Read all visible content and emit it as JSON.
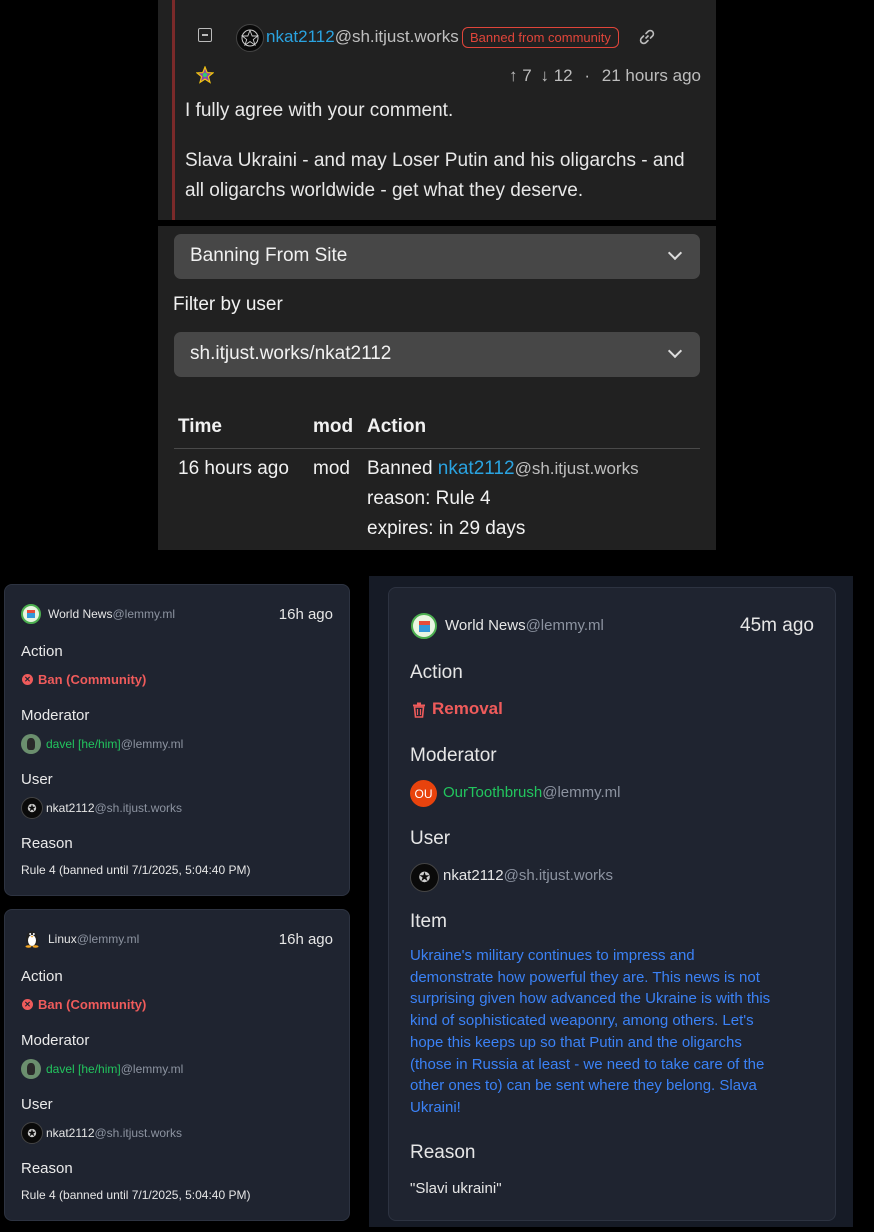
{
  "comment": {
    "username": "nkat2112",
    "instance": "@sh.itjust.works",
    "badge": "Banned from community",
    "upvotes": "7",
    "downvotes": "12",
    "separator": "·",
    "time": "21 hours ago",
    "paragraph1": "I fully agree with your comment.",
    "paragraph2": "Slava Ukraini - and may Loser Putin and his oligarchs - and all oligarchs worldwide - get what they deserve."
  },
  "modlog_mobile": {
    "action_filter": "Banning From Site",
    "filter_label": "Filter by user",
    "user_filter": "sh.itjust.works/nkat2112",
    "headers": [
      "Time",
      "mod",
      "Action"
    ],
    "row": {
      "time": "16 hours ago",
      "mod": "mod",
      "action_prefix": "Banned",
      "user": "nkat2112",
      "user_instance": "@sh.itjust.works",
      "reason": "reason: Rule 4",
      "expires": "expires: in 29 days"
    }
  },
  "card_world_ban": {
    "community": "World News",
    "community_instance": "@lemmy.ml",
    "time": "16h ago",
    "action_heading": "Action",
    "action": "Ban (Community)",
    "moderator_heading": "Moderator",
    "moderator": "davel [he/him]",
    "moderator_instance": "@lemmy.ml",
    "user_heading": "User",
    "user": "nkat2112",
    "user_instance": "@sh.itjust.works",
    "reason_heading": "Reason",
    "reason": "Rule 4 (banned until 7/1/2025, 5:04:40 PM)"
  },
  "card_linux_ban": {
    "community": "Linux",
    "community_instance": "@lemmy.ml",
    "time": "16h ago",
    "action_heading": "Action",
    "action": "Ban (Community)",
    "moderator_heading": "Moderator",
    "moderator": "davel [he/him]",
    "moderator_instance": "@lemmy.ml",
    "user_heading": "User",
    "user": "nkat2112",
    "user_instance": "@sh.itjust.works",
    "reason_heading": "Reason",
    "reason": "Rule 4 (banned until 7/1/2025, 5:04:40 PM)"
  },
  "card_removal": {
    "community": "World News",
    "community_instance": "@lemmy.ml",
    "time": "45m ago",
    "action_heading": "Action",
    "action": "Removal",
    "moderator_heading": "Moderator",
    "moderator_avatar": "OU",
    "moderator": "OurToothbrush",
    "moderator_instance": "@lemmy.ml",
    "user_heading": "User",
    "user": "nkat2112",
    "user_instance": "@sh.itjust.works",
    "item_heading": "Item",
    "item_lines": [
      "Ukraine's military continues to impress and",
      "demonstrate how powerful they are. This news is not",
      "surprising given how advanced the Ukraine is with this",
      "kind of sophisticated weaponry, among others. Let's",
      "hope this keeps up so that Putin and the oligarchs",
      "(those in Russia at least - we need to take care of the",
      "other ones to) can be sent where they belong. Slava",
      "Ukraini!"
    ],
    "reason_heading": "Reason",
    "reason": "\"Slavi ukraini\""
  },
  "icons": [
    "collapse-icon",
    "link-icon",
    "upvote-icon",
    "downvote-icon",
    "chevron-down-icon",
    "ban-icon",
    "trash-icon",
    "penguin-icon",
    "community-icon",
    "avatar"
  ],
  "colors": {
    "accent_blue": "#2aa3e0",
    "ban_red": "#ef5b5b",
    "mod_green": "#22c55e",
    "item_blue": "#3b82f6",
    "card_bg": "#1f2430"
  }
}
